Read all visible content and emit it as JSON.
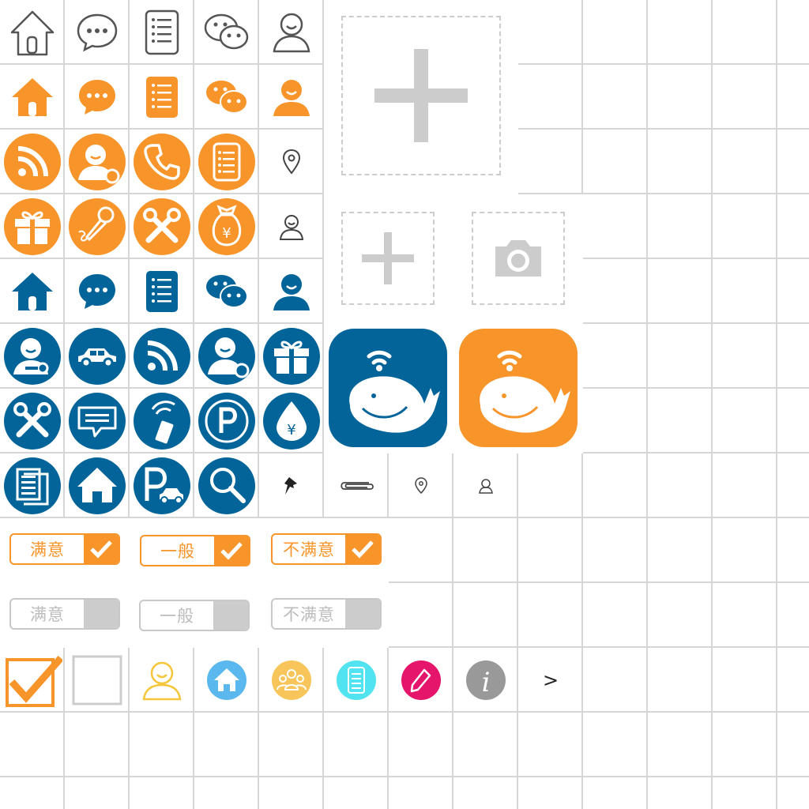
{
  "colors": {
    "orange": "#f7942a",
    "blue": "#03649a",
    "gray_outline": "#555555",
    "dashed": "#cccccc",
    "disabled": "#cccccc"
  },
  "outline_icons": [
    "home-icon",
    "chat-icon",
    "list-icon",
    "wechat-icon",
    "user-icon"
  ],
  "orange_icons": [
    "home-icon",
    "chat-icon",
    "list-icon",
    "wechat-icon",
    "user-icon",
    "rss-icon",
    "user-add-icon",
    "phone-icon",
    "list-icon",
    "location-icon",
    "gift-icon",
    "microphone-icon",
    "tools-icon",
    "money-bag-icon",
    "user-icon"
  ],
  "blue_icons": [
    "home-icon",
    "chat-icon",
    "list-icon",
    "wechat-icon",
    "user-icon",
    "user-key-icon",
    "car-icon",
    "rss-icon",
    "user-add-icon",
    "gift-icon",
    "tools-icon",
    "message-icon",
    "mobile-icon",
    "parking-icon",
    "money-drop-icon",
    "document-icon",
    "house-icon",
    "parking-car-icon",
    "search-icon"
  ],
  "small_icons": [
    "pushpin-icon",
    "paperclip-icon",
    "location-icon",
    "user-icon"
  ],
  "upload": {
    "large": "add-photo-icon",
    "small": "add-icon",
    "camera": "camera-icon"
  },
  "app_icons": [
    "whale-app-icon",
    "whale-app-icon"
  ],
  "ratings": {
    "active": [
      {
        "label": "满意"
      },
      {
        "label": "一般"
      },
      {
        "label": "不满意"
      }
    ],
    "inactive": [
      {
        "label": "满意"
      },
      {
        "label": "一般"
      },
      {
        "label": "不满意"
      }
    ]
  },
  "bottom_row": {
    "items": [
      "checkbox-checked-icon",
      "checkbox-empty-icon",
      "user-icon",
      "home-icon",
      "group-icon",
      "list-icon",
      "edit-icon",
      "info-icon"
    ],
    "arrow": ">"
  }
}
